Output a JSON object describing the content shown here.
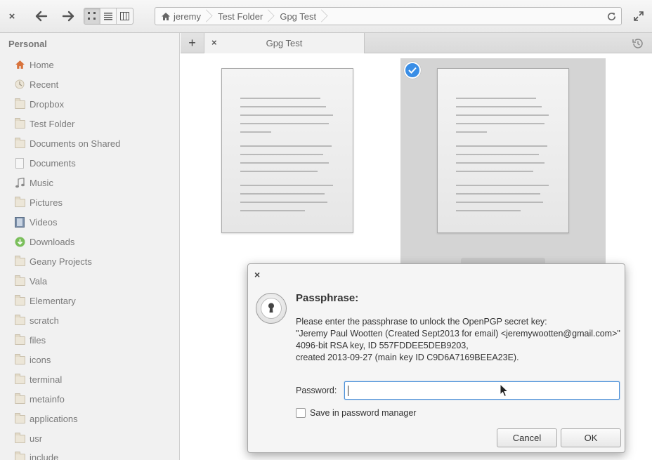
{
  "header": {
    "close_label": "×",
    "breadcrumbs": [
      "jeremy",
      "Test Folder",
      "Gpg Test"
    ]
  },
  "sidebar": {
    "heading": "Personal",
    "items": [
      {
        "label": "Home",
        "icon": "home-icon"
      },
      {
        "label": "Recent",
        "icon": "recent-icon"
      },
      {
        "label": "Dropbox",
        "icon": "folder-icon"
      },
      {
        "label": "Test Folder",
        "icon": "folder-icon"
      },
      {
        "label": "Documents on Shared",
        "icon": "folder-icon"
      },
      {
        "label": "Documents",
        "icon": "documents-icon"
      },
      {
        "label": "Music",
        "icon": "music-icon"
      },
      {
        "label": "Pictures",
        "icon": "folder-icon"
      },
      {
        "label": "Videos",
        "icon": "videos-icon"
      },
      {
        "label": "Downloads",
        "icon": "downloads-icon"
      },
      {
        "label": "Geany Projects",
        "icon": "folder-icon"
      },
      {
        "label": "Vala",
        "icon": "folder-icon"
      },
      {
        "label": "Elementary",
        "icon": "folder-icon"
      },
      {
        "label": "scratch",
        "icon": "folder-icon"
      },
      {
        "label": "files",
        "icon": "folder-icon"
      },
      {
        "label": "icons",
        "icon": "folder-icon"
      },
      {
        "label": "terminal",
        "icon": "folder-icon"
      },
      {
        "label": "metainfo",
        "icon": "folder-icon"
      },
      {
        "label": "applications",
        "icon": "folder-icon"
      },
      {
        "label": "usr",
        "icon": "folder-icon"
      },
      {
        "label": "include",
        "icon": "folder-icon"
      }
    ]
  },
  "tabs": {
    "new_tab_label": "+",
    "close_label": "×",
    "active_tab": "Gpg Test"
  },
  "dialog": {
    "close_label": "×",
    "title": "Passphrase:",
    "message_lines": [
      "Please enter the passphrase to unlock the OpenPGP secret key:",
      "\"Jeremy Paul Wootten (Created Sept2013 for email) <jeremywootten@gmail.com>\"",
      "4096-bit RSA key, ID 557FDDEE5DEB9203,",
      "created 2013-09-27 (main key ID C9D6A7169BEEA23E)."
    ],
    "password_label": "Password:",
    "password_value": "",
    "save_label": "Save in password manager",
    "save_checked": false,
    "cancel_label": "Cancel",
    "ok_label": "OK"
  },
  "colors": {
    "accent": "#3a8ee6",
    "sidebar_bg": "#f1f1f1",
    "selection_bg": "#d4d4d4"
  }
}
